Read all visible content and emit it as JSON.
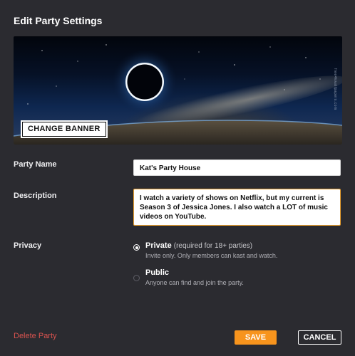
{
  "dialog": {
    "title": "Edit Party Settings",
    "banner": {
      "button_label": "CHANGE BANNER",
      "image": "solar-eclipse-over-earth",
      "watermark": "free4kwallpapers.com"
    },
    "party_name": {
      "label": "Party Name",
      "value": "Kat's Party House"
    },
    "description": {
      "label": "Description",
      "value": "I watch a variety of shows on Netflix, but my current is Season 3 of Jessica Jones. I also watch a LOT of music videos on YouTube."
    },
    "privacy": {
      "label": "Privacy",
      "options": [
        {
          "title": "Private",
          "note": "(required for 18+ parties)",
          "desc": "Invite only. Only members can kast and watch.",
          "selected": true
        },
        {
          "title": "Public",
          "note": "",
          "desc": "Anyone can find and join the party.",
          "selected": false
        }
      ]
    },
    "actions": {
      "delete_label": "Delete Party",
      "save_label": "SAVE",
      "cancel_label": "CANCEL"
    }
  },
  "colors": {
    "background": "#2b2b30",
    "accent": "#f7941d",
    "danger": "#d9534f",
    "focus_border": "#e8a030"
  }
}
